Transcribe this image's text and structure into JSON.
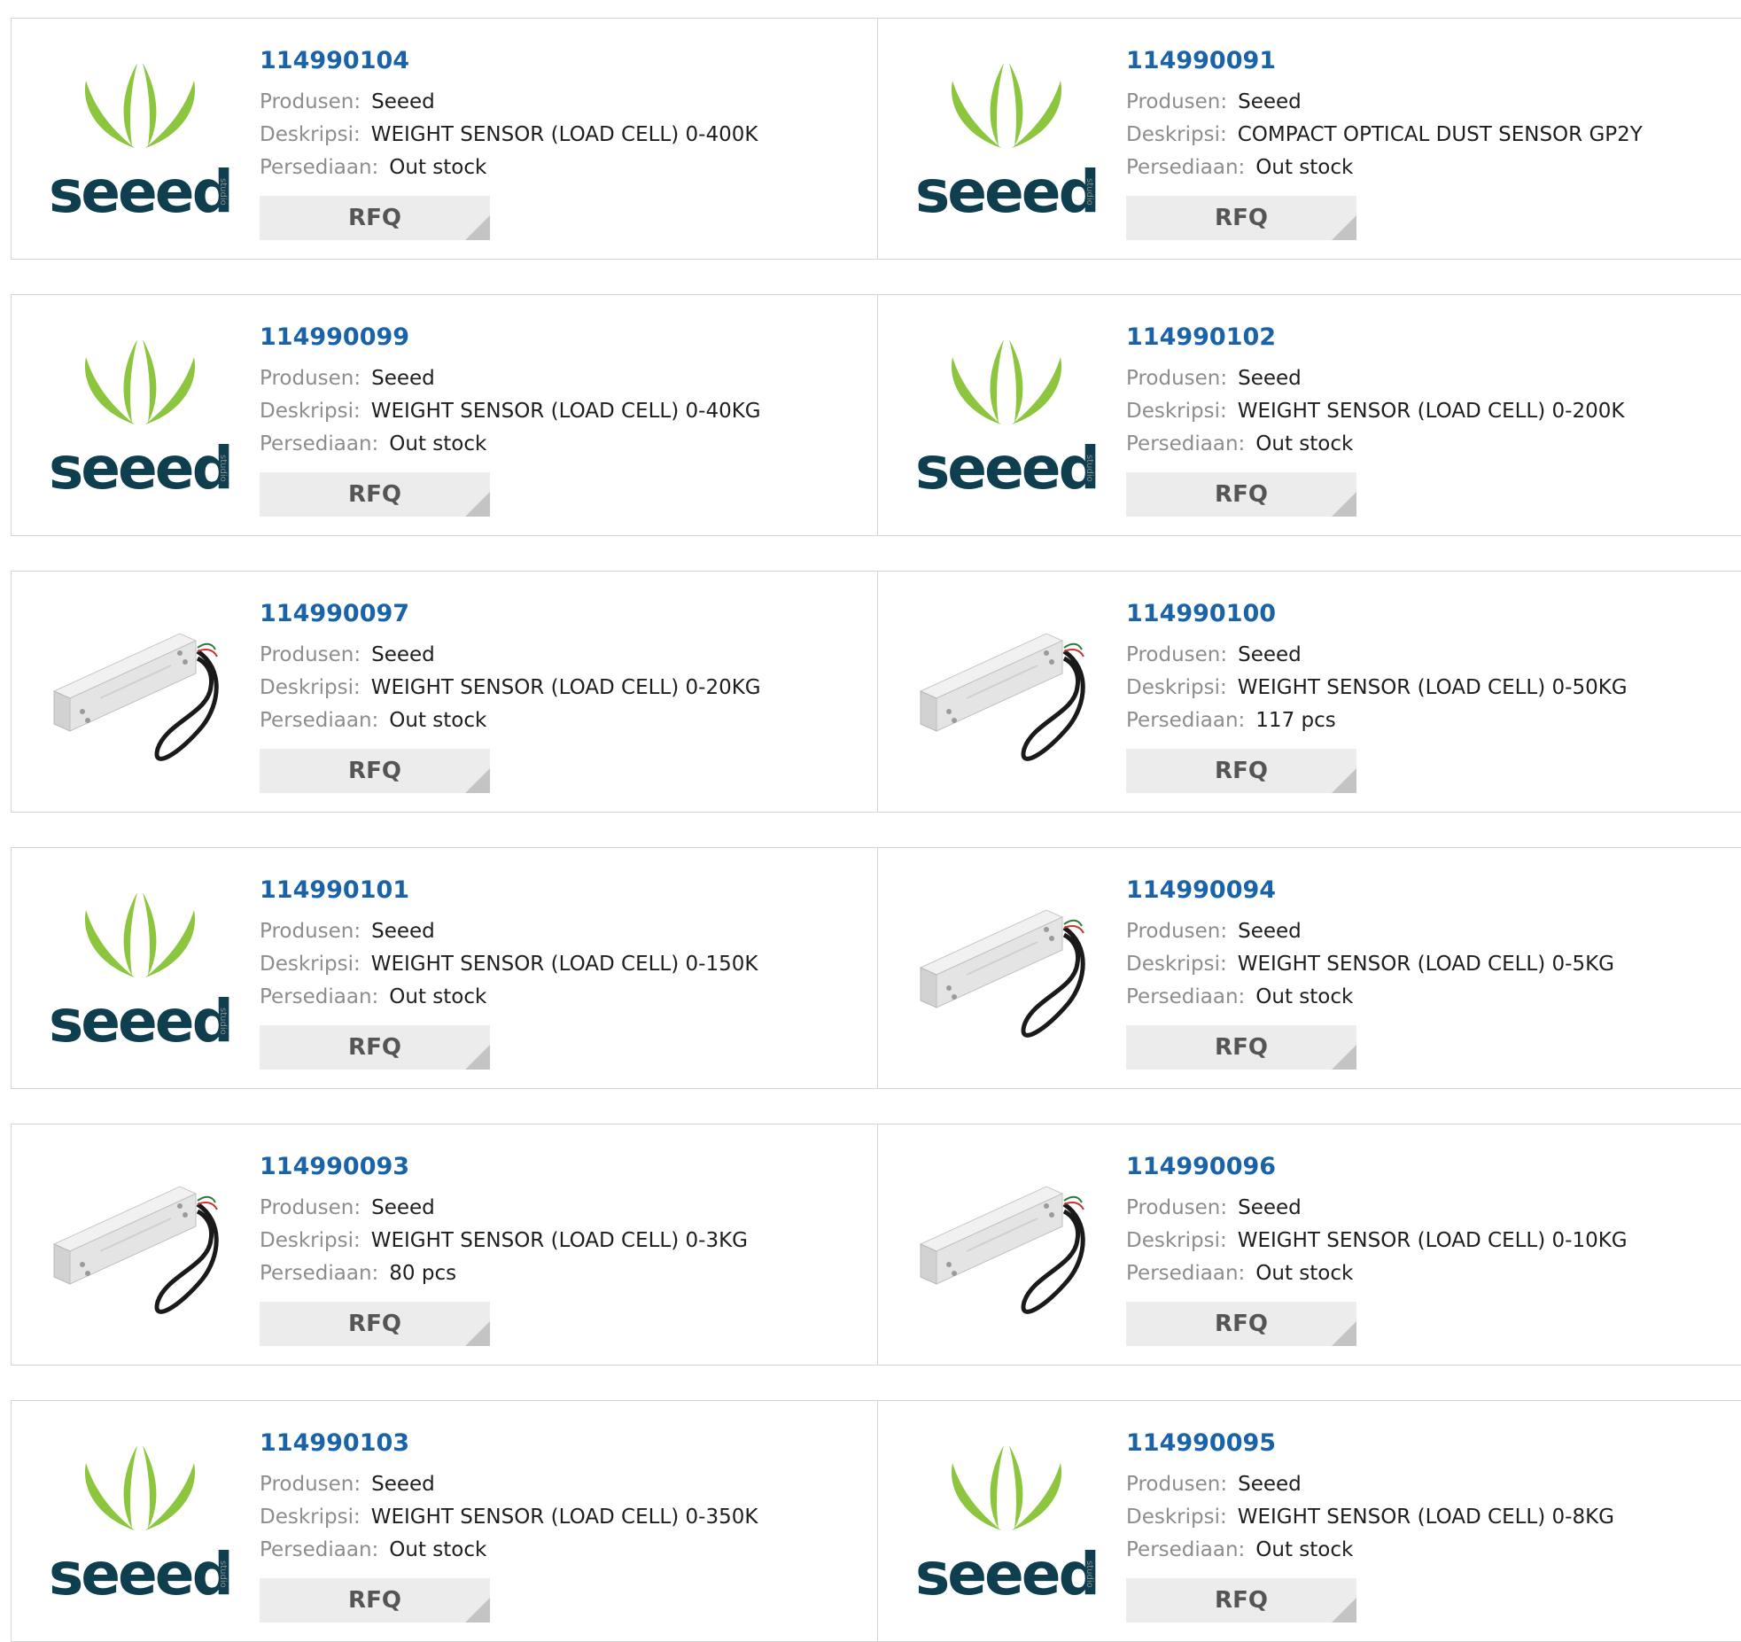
{
  "labels": {
    "manufacturer": "Produsen:",
    "description": "Deskripsi:",
    "stock": "Persediaan:",
    "rfq": "RFQ"
  },
  "colors": {
    "link": "#1a63a8",
    "logo_green": "#8cc63f",
    "logo_teal": "#0f3e4e",
    "button_bg": "#ececec"
  },
  "products": [
    {
      "part": "114990104",
      "manufacturer": "Seeed",
      "description": "WEIGHT SENSOR (LOAD CELL) 0-400K",
      "stock": "Out stock",
      "image": "seeed-logo",
      "logo_text": "seeed",
      "logo_sub": "studio"
    },
    {
      "part": "114990091",
      "manufacturer": "Seeed",
      "description": "COMPACT OPTICAL DUST SENSOR GP2Y",
      "stock": "Out stock",
      "image": "seeed-logo",
      "logo_text": "seeed",
      "logo_sub": "studio"
    },
    {
      "part": "114990099",
      "manufacturer": "Seeed",
      "description": "WEIGHT SENSOR (LOAD CELL) 0-40KG",
      "stock": "Out stock",
      "image": "seeed-logo",
      "logo_text": "seeed",
      "logo_sub": "studio"
    },
    {
      "part": "114990102",
      "manufacturer": "Seeed",
      "description": "WEIGHT SENSOR (LOAD CELL) 0-200K",
      "stock": "Out stock",
      "image": "seeed-logo",
      "logo_text": "seeed",
      "logo_sub": "studio"
    },
    {
      "part": "114990097",
      "manufacturer": "Seeed",
      "description": "WEIGHT SENSOR (LOAD CELL) 0-20KG",
      "stock": "Out stock",
      "image": "load-cell-photo"
    },
    {
      "part": "114990100",
      "manufacturer": "Seeed",
      "description": "WEIGHT SENSOR (LOAD CELL) 0-50KG",
      "stock": "117 pcs",
      "image": "load-cell-photo"
    },
    {
      "part": "114990101",
      "manufacturer": "Seeed",
      "description": "WEIGHT SENSOR (LOAD CELL) 0-150K",
      "stock": "Out stock",
      "image": "seeed-logo",
      "logo_text": "seeed",
      "logo_sub": "studio"
    },
    {
      "part": "114990094",
      "manufacturer": "Seeed",
      "description": "WEIGHT SENSOR (LOAD CELL) 0-5KG",
      "stock": "Out stock",
      "image": "load-cell-photo"
    },
    {
      "part": "114990093",
      "manufacturer": "Seeed",
      "description": "WEIGHT SENSOR (LOAD CELL) 0-3KG",
      "stock": "80 pcs",
      "image": "load-cell-photo"
    },
    {
      "part": "114990096",
      "manufacturer": "Seeed",
      "description": "WEIGHT SENSOR (LOAD CELL) 0-10KG",
      "stock": "Out stock",
      "image": "load-cell-photo"
    },
    {
      "part": "114990103",
      "manufacturer": "Seeed",
      "description": "WEIGHT SENSOR (LOAD CELL) 0-350K",
      "stock": "Out stock",
      "image": "seeed-logo",
      "logo_text": "seeed",
      "logo_sub": "studio"
    },
    {
      "part": "114990095",
      "manufacturer": "Seeed",
      "description": "WEIGHT SENSOR (LOAD CELL) 0-8KG",
      "stock": "Out stock",
      "image": "seeed-logo",
      "logo_text": "seeed",
      "logo_sub": "studio"
    }
  ]
}
